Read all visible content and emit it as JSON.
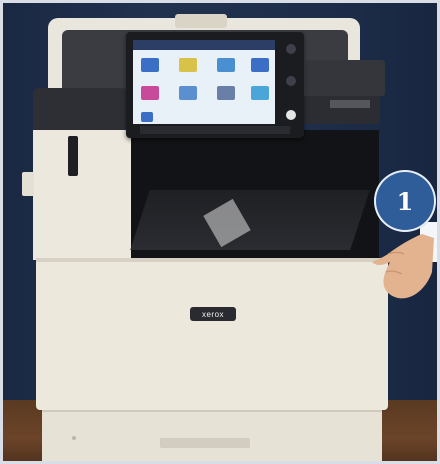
{
  "scene": {
    "brand_label": "xerox",
    "callout": {
      "number": "1",
      "color": "#2e5d9a"
    }
  },
  "colors": {
    "wall": "#1e2e4a",
    "floor": "#6b4428",
    "printer_body": "#ece8dc",
    "printer_dark": "#3a3c42",
    "screen": "#e8f0f8"
  },
  "screen_icons": [
    {
      "name": "copy-icon",
      "color": "#3b6fc6"
    },
    {
      "name": "scan-icon",
      "color": "#d8c24a"
    },
    {
      "name": "email-icon",
      "color": "#4a8fd0"
    },
    {
      "name": "print-icon",
      "color": "#c84a9a"
    },
    {
      "name": "fax-icon",
      "color": "#5a8fd0"
    },
    {
      "name": "settings-icon",
      "color": "#6a7fa8"
    },
    {
      "name": "apps-icon",
      "color": "#4aa6d8"
    },
    {
      "name": "id-card-icon",
      "color": "#3b6fc6"
    }
  ]
}
